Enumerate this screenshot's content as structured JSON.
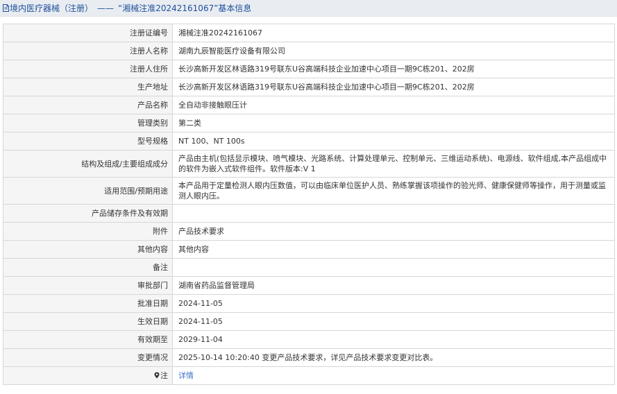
{
  "header": {
    "category": "境内医疗器械（注册）",
    "separator": "——",
    "title": "“湘械注准20242161067”基本信息"
  },
  "rows": [
    {
      "label": "注册证编号",
      "value": "湘械注准20242161067"
    },
    {
      "label": "注册人名称",
      "value": "湖南九辰智能医疗设备有限公司"
    },
    {
      "label": "注册人住所",
      "value": "长沙高新开发区林语路319号联东U谷高端科技企业加速中心项目一期9C栋201、202房"
    },
    {
      "label": "生产地址",
      "value": "长沙高新开发区林语路319号联东U谷高端科技企业加速中心项目一期9C栋201、202房"
    },
    {
      "label": "产品名称",
      "value": "全自动非接触眼压计"
    },
    {
      "label": "管理类别",
      "value": "第二类"
    },
    {
      "label": "型号规格",
      "value": "NT 100、NT 100s"
    },
    {
      "label": "结构及组成/主要组成成分",
      "value": "产品由主机(包括显示模块、喷气模块、光路系统、计算处理单元、控制单元、三维运动系统)、电源线、软件组成,本产品组成中的软件为嵌入式软件组件。软件版本:V 1"
    },
    {
      "label": "适用范围/预期用途",
      "value": "本产品用于定量检测人眼内压数值，可以由临床单位医护人员、熟练掌握该项操作的验光师、健康保健师等操作，用于测量或监测人眼内压。"
    },
    {
      "label": "产品储存条件及有效期",
      "value": ""
    },
    {
      "label": "附件",
      "value": "产品技术要求"
    },
    {
      "label": "其他内容",
      "value": "其他内容"
    },
    {
      "label": "备注",
      "value": ""
    },
    {
      "label": "审批部门",
      "value": "湖南省药品监督管理局"
    },
    {
      "label": "批准日期",
      "value": "2024-11-05"
    },
    {
      "label": "生效日期",
      "value": "2024-11-05"
    },
    {
      "label": "有效期至",
      "value": "2029-11-04"
    },
    {
      "label": "变更情况",
      "value": "2025-10-14 10:20:40 变更产品技术要求，详见产品技术要求变更对比表。"
    }
  ],
  "note_row": {
    "label": "注",
    "link": "详情"
  },
  "colors": {
    "title": "#1f4e9a",
    "link": "#3a74c7",
    "label_bg": "#f5f5f5",
    "header_bg": "#e9edf2"
  },
  "icons": {
    "header": "document-icon",
    "note": "map-pin-icon"
  }
}
